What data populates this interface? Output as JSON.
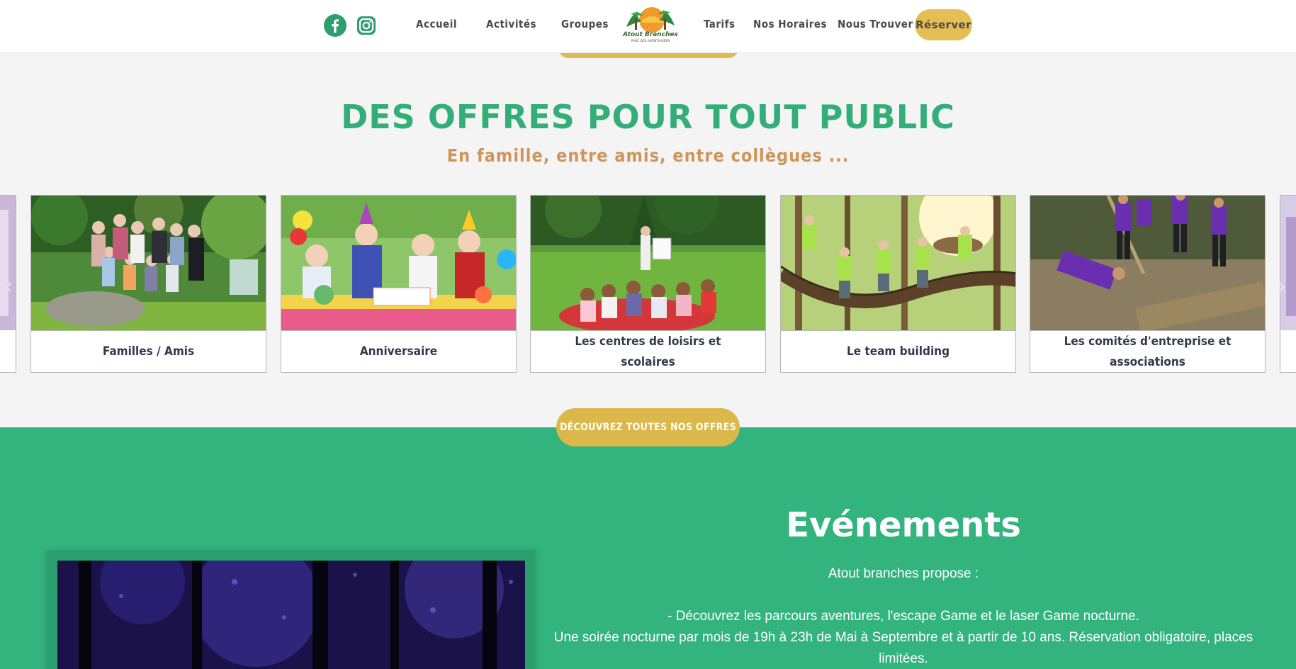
{
  "header": {
    "social": [
      {
        "name": "facebook-icon"
      },
      {
        "name": "instagram-icon"
      }
    ],
    "nav_left": [
      {
        "label": "Accueil"
      },
      {
        "label": "Activités"
      },
      {
        "label": "Groupes"
      }
    ],
    "logo_text": "Atout Branches",
    "nav_right": [
      {
        "label": "Tarifs"
      },
      {
        "label": "Nos Horaires"
      },
      {
        "label": "Nous Trouver"
      }
    ],
    "reserve_label": "Réserver"
  },
  "offers": {
    "title": "Des offres pour tout public",
    "subtitle": "En famille, entre amis, entre collègues ...",
    "cards": [
      {
        "label": "Familles / Amis"
      },
      {
        "label": "Anniversaire"
      },
      {
        "label": "Les centres de loisirs et scolaires"
      },
      {
        "label": "Le team building"
      },
      {
        "label": "Les comités d'entreprise et associations"
      }
    ],
    "cta_label": "DÉCOUVREZ TOUTES NOS OFFRES"
  },
  "events": {
    "title": "Evénements",
    "intro": "Atout branches propose :",
    "line1": "- Découvrez les parcours aventures, l'escape Game et le laser Game nocturne.",
    "line2": "Une soirée nocturne par mois de 19h à 23h de Mai à Septembre et à partir de 10 ans. Réservation obligatoire, places limitées."
  },
  "colors": {
    "brand_green": "#34ae78",
    "events_bg": "#33b37e",
    "gold": "#e5bf55",
    "subtitle_orange": "#cf9457"
  }
}
